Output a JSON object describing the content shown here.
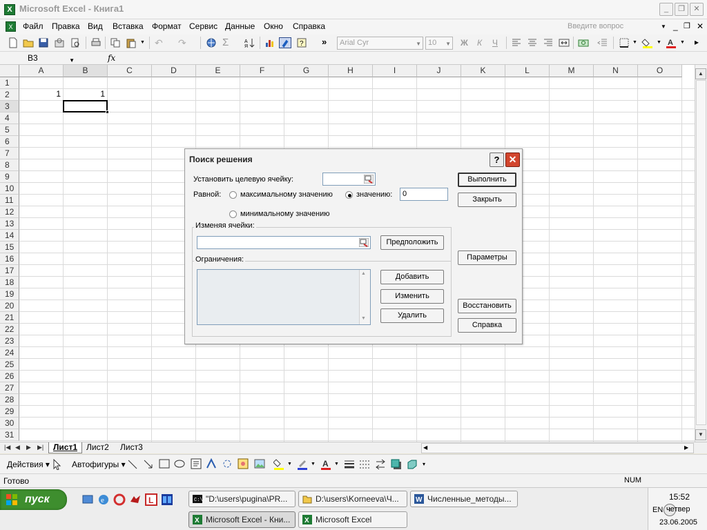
{
  "window": {
    "title": "Microsoft Excel - Книга1",
    "min_label": "_",
    "restore_label": "❐",
    "close_label": "✕"
  },
  "menu": {
    "items": [
      "Файл",
      "Правка",
      "Вид",
      "Вставка",
      "Формат",
      "Сервис",
      "Данные",
      "Окно",
      "Справка"
    ],
    "help_placeholder": "Введите вопрос"
  },
  "toolbar": {
    "font_name": "Arial Cyr",
    "font_size": "10",
    "bold_label": "Ж",
    "italic_label": "К",
    "underline_label": "Ч",
    "sigma_label": "Σ",
    "chevron_label": "»"
  },
  "formula_bar": {
    "name_box": "B3",
    "fx_label": "fx",
    "formula": ""
  },
  "grid": {
    "columns": [
      "A",
      "B",
      "C",
      "D",
      "E",
      "F",
      "G",
      "H",
      "I",
      "J",
      "K",
      "L",
      "M",
      "N",
      "O"
    ],
    "rows": [
      "1",
      "2",
      "3",
      "4",
      "5",
      "6",
      "7",
      "8",
      "9",
      "10",
      "11",
      "12",
      "13",
      "14",
      "15",
      "16",
      "17",
      "18",
      "19",
      "20",
      "21",
      "22",
      "23",
      "24",
      "25",
      "26",
      "27",
      "28",
      "29",
      "30",
      "31"
    ],
    "cells": {
      "A2": "1",
      "B2": "1"
    },
    "selected": "B3"
  },
  "sheets": {
    "tabs": [
      "Лист1",
      "Лист2",
      "Лист3"
    ],
    "active": "Лист1"
  },
  "drawing": {
    "actions_label": "Действия",
    "autoshapes_label": "Автофигуры"
  },
  "status": {
    "left": "Готово",
    "num": "NUM"
  },
  "dialog": {
    "title": "Поиск решения",
    "target_label": "Установить целевую ячейку:",
    "target_value": "",
    "equal_label": "Равной:",
    "max_label": "максимальному значению",
    "value_label": "значению:",
    "value": "0",
    "min_label": "минимальному значению",
    "changing_label": "Изменяя ячейки:",
    "changing_value": "",
    "constraints_label": "Ограничения:",
    "buttons": {
      "run": "Выполнить",
      "close": "Закрыть",
      "guess": "Предположить",
      "options": "Параметры",
      "add": "Добавить",
      "change": "Изменить",
      "delete": "Удалить",
      "reset": "Восстановить",
      "help": "Справка"
    }
  },
  "taskbar": {
    "start_label": "пуск",
    "tasks_top": [
      "\"D:\\users\\pugina\\PR...",
      "D:\\users\\Korneeva\\Ч...",
      "Численные_методы..."
    ],
    "tasks_bottom": [
      "Microsoft Excel - Кни...",
      "Microsoft Excel"
    ],
    "lang": "EN",
    "time": "15:52",
    "day": "четвер",
    "date": "23.06.2005"
  }
}
